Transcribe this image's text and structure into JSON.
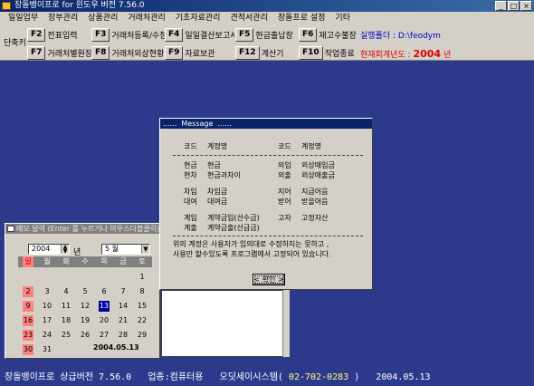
{
  "window": {
    "title": "장돌뱅이프로 for 윈도우 버전 7.56.0",
    "controls": [
      "_",
      "□",
      "×"
    ]
  },
  "menu": [
    "일일업무",
    "장부관리",
    "상품관리",
    "거래처관리",
    "기초자료관리",
    "견적서관리",
    "장돌프로 설정",
    "기타"
  ],
  "toolbar": {
    "shortcut_label": "단축키",
    "row1": [
      {
        "key": "F2",
        "label": "전표입력"
      },
      {
        "key": "F3",
        "label": "거래처등록/수정"
      },
      {
        "key": "F4",
        "label": "일일결산보고서"
      },
      {
        "key": "F5",
        "label": "현금출납장"
      },
      {
        "key": "F6",
        "label": "재고수불장"
      }
    ],
    "row2": [
      {
        "key": "F7",
        "label": "거래처별원장"
      },
      {
        "key": "F8",
        "label": "거래처외상현황"
      },
      {
        "key": "F9",
        "label": "자료보관"
      },
      {
        "key": "F12",
        "label": "계산기"
      },
      {
        "key": "F10",
        "label": "작업종료"
      }
    ],
    "folder_text": "실행폴더 : D:\\feodym",
    "fiscal_text": "현재회계년도 :",
    "fiscal_year": "2004",
    "fiscal_suffix": "년"
  },
  "message": {
    "title": "......  Message  ......",
    "headers": [
      "코드",
      "계정명",
      "코드",
      "계정명"
    ],
    "rows": [
      [
        "현금",
        "현금",
        "외입",
        "외상매입금"
      ],
      [
        "현차",
        "현금과차이",
        "외출",
        "외상매출금"
      ],
      [
        "차입",
        "차입금",
        "지어",
        "지급어음"
      ],
      [
        "대여",
        "대여금",
        "받어",
        "받을어음"
      ],
      [
        "계입",
        "계약금입(선수금)",
        "고자",
        "고정자산"
      ],
      [
        "계출",
        "계약금출(선급금)",
        "",
        ""
      ]
    ],
    "note1": "위의 계정은 사용자가 임의대로 수정하지는 못하고 ,",
    "note2": "사용만 할수있도록 프로그램에서 고정되어 있습니다.",
    "ok": "< 확인 >"
  },
  "memo": {
    "title": "메모 달력 (Enter 를 누르거나 마우스더블클릭)",
    "year": "2004",
    "year_suffix": "년",
    "month": "5 월",
    "weekdays": [
      "일",
      "월",
      "화",
      "수",
      "목",
      "금",
      "토"
    ],
    "weeks": [
      [
        "",
        "",
        "",
        "",
        "",
        "",
        "1"
      ],
      [
        "2",
        "3",
        "4",
        "5",
        "6",
        "7",
        "8"
      ],
      [
        "9",
        "10",
        "11",
        "12",
        "13",
        "14",
        "15"
      ],
      [
        "16",
        "17",
        "18",
        "19",
        "20",
        "21",
        "22"
      ],
      [
        "23",
        "24",
        "25",
        "26",
        "27",
        "28",
        "29"
      ],
      [
        "30",
        "31",
        "",
        "",
        "",
        "",
        ""
      ]
    ],
    "today": "13",
    "date_text": "2004.05.13"
  },
  "status": {
    "left": "장돌뱅이프로 상급버전 7.56.0   업종:컴퓨터용   오딧세이시스템(",
    "phone": " 02-702-0283 ",
    "right": ")   2004.05.13"
  }
}
